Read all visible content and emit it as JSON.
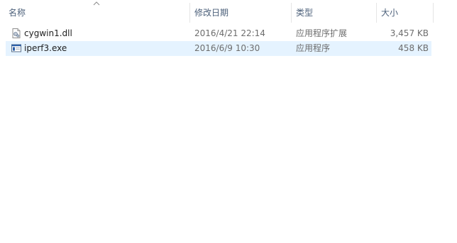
{
  "columns": {
    "name": "名称",
    "date": "修改日期",
    "type": "类型",
    "size": "大小"
  },
  "sort": {
    "column": "name",
    "direction": "ascending",
    "icon": "sort-up-caret-icon"
  },
  "files": [
    {
      "name": "cygwin1.dll",
      "date": "2016/4/21 22:14",
      "type": "应用程序扩展",
      "size": "3,457 KB",
      "icon": "dll-file-icon",
      "selected": false
    },
    {
      "name": "iperf3.exe",
      "date": "2016/6/9 10:30",
      "type": "应用程序",
      "size": "458 KB",
      "icon": "exe-file-icon",
      "selected": true
    }
  ],
  "colors": {
    "header_text": "#4c607a",
    "selection": "#e5f3ff",
    "detail_text": "#6d6d6d"
  }
}
